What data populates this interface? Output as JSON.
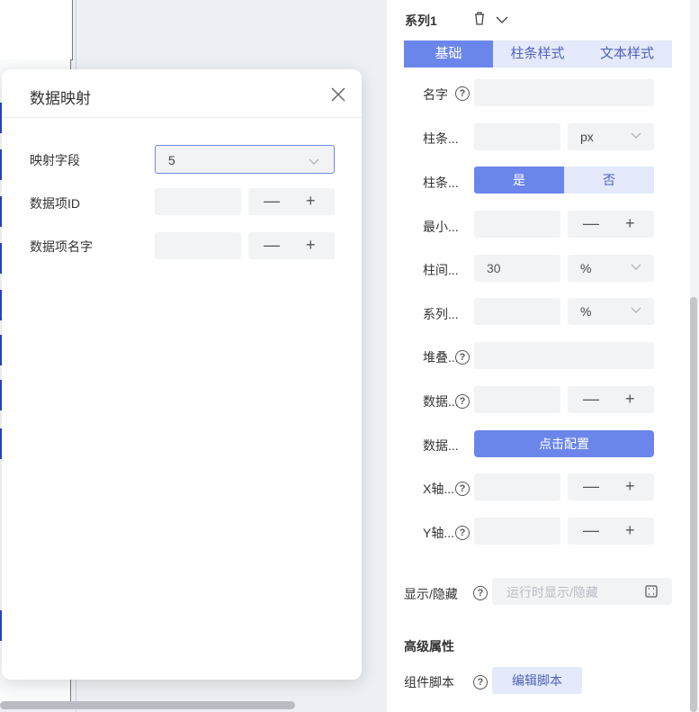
{
  "canvas": {},
  "dialog": {
    "title": "数据映射",
    "fields": {
      "mapping_field": {
        "label": "映射字段",
        "value": "5"
      },
      "item_id": {
        "label": "数据项ID",
        "value": ""
      },
      "item_name": {
        "label": "数据项名字",
        "value": ""
      }
    },
    "stepper": {
      "minus": "—",
      "plus": "+"
    }
  },
  "panel": {
    "series_title": "系列1",
    "tabs": [
      "基础",
      "柱条样式",
      "文本样式"
    ],
    "rows": {
      "name": {
        "label": "名字",
        "value": ""
      },
      "bar_width": {
        "label": "柱条...",
        "value": "",
        "unit": "px"
      },
      "bar_toggle": {
        "label": "柱条...",
        "yes": "是",
        "no": "否"
      },
      "min_height": {
        "label": "最小...",
        "value": ""
      },
      "bar_gap": {
        "label": "柱间...",
        "value": "30",
        "unit": "%"
      },
      "series_gap": {
        "label": "系列...",
        "value": "",
        "unit": "%"
      },
      "stack": {
        "label": "堆叠...",
        "value": ""
      },
      "data_a": {
        "label": "数据...",
        "value": ""
      },
      "data_b": {
        "label": "数据...",
        "button": "点击配置"
      },
      "x_axis": {
        "label": "X轴...",
        "value": ""
      },
      "y_axis": {
        "label": "Y轴...",
        "value": ""
      }
    },
    "visibility": {
      "label": "显示/隐藏",
      "placeholder": "运行时显示/隐藏"
    },
    "advanced": {
      "title": "高级属性",
      "script_label": "组件脚本",
      "script_button": "编辑脚本"
    },
    "help_glyph": "?"
  },
  "icons": {
    "trash": "trash-icon",
    "chevron": "chevron-down-icon",
    "close": "close-icon",
    "expand": "expand-icon"
  }
}
